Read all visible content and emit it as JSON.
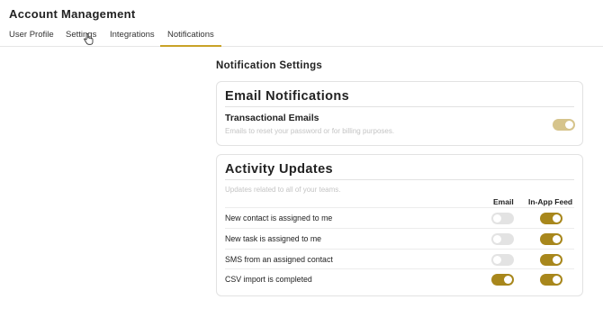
{
  "app": {
    "title": "Account Management"
  },
  "tabs": [
    {
      "label": "User Profile"
    },
    {
      "label": "Settings"
    },
    {
      "label": "Integrations"
    },
    {
      "label": "Notifications",
      "active": true
    }
  ],
  "page": {
    "title": "Notification Settings"
  },
  "email_card": {
    "title": "Email Notifications",
    "item_title": "Transactional Emails",
    "item_desc": "Emails to reset your password or for billing purposes.",
    "toggle_state": "on (disabled)"
  },
  "activity_card": {
    "title": "Activity Updates",
    "desc": "Updates related to all of your teams.",
    "columns": [
      "Email",
      "In-App Feed"
    ],
    "rows": [
      {
        "label": "New contact is assigned to me",
        "email": false,
        "feed": true
      },
      {
        "label": "New task is assigned to me",
        "email": false,
        "feed": true
      },
      {
        "label": "SMS from an assigned contact",
        "email": false,
        "feed": true
      },
      {
        "label": "CSV import is completed",
        "email": true,
        "feed": true
      }
    ]
  },
  "colors": {
    "accent": "#a8871c",
    "accent_disabled": "#d6c48c",
    "toggle_off": "#e3e3e3"
  }
}
